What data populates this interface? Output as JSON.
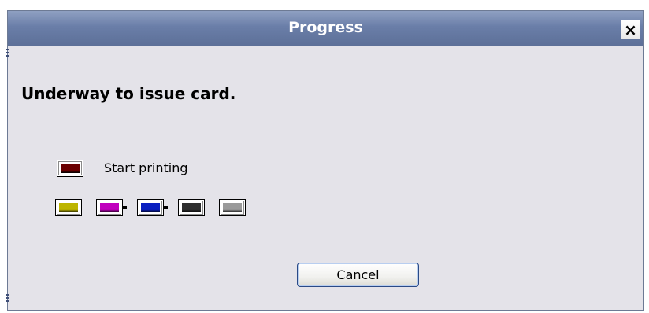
{
  "window": {
    "title": "Progress",
    "close_label": "×"
  },
  "main": {
    "message": "Underway to issue card.",
    "status_label": "Start printing",
    "status_color": "#6b0000"
  },
  "swatches": [
    {
      "name": "yellow",
      "color": "#bdb500"
    },
    {
      "name": "magenta",
      "color": "#c000bd"
    },
    {
      "name": "blue",
      "color": "#0a1fc0"
    },
    {
      "name": "black",
      "color": "#2f2f2f"
    },
    {
      "name": "overlay",
      "color": "#9a9a9a"
    }
  ],
  "footer": {
    "cancel_label": "Cancel"
  },
  "colors": {
    "titlebar": "#6a7ea8",
    "dialog_bg": "#e4e3e9"
  }
}
